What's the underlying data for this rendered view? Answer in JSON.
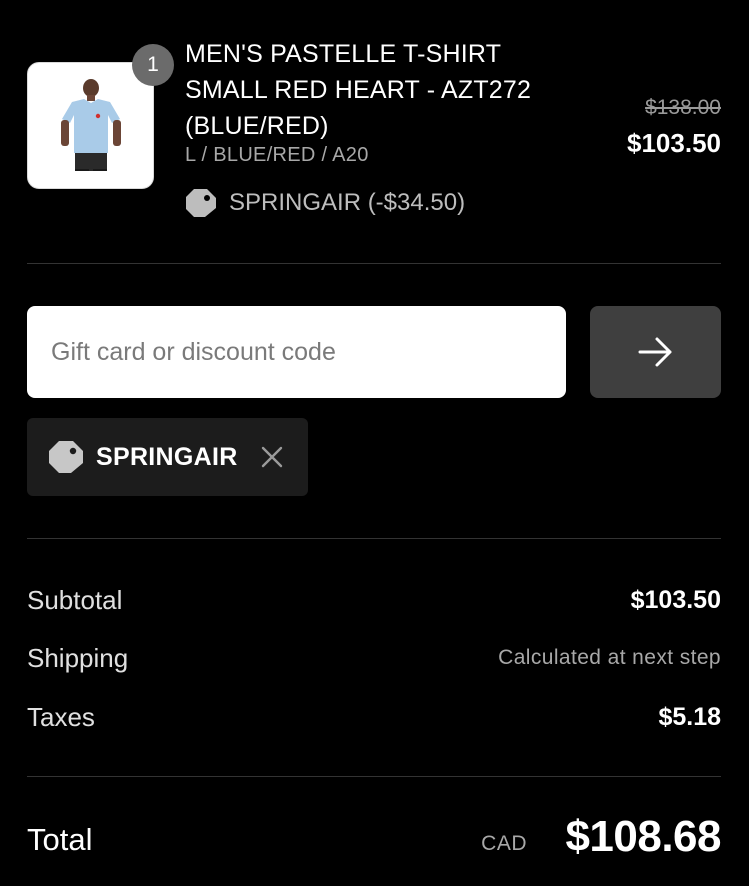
{
  "line_item": {
    "quantity": "1",
    "name": "MEN'S PASTELLE T-SHIRT SMALL RED HEART - AZT272 (BLUE/RED)",
    "variant": "L / BLUE/RED / A20",
    "discount_label": "SPRINGAIR (-$34.50)",
    "original_price": "$138.00",
    "price": "$103.50",
    "image_icon": "tshirt-image"
  },
  "discount_form": {
    "placeholder": "Gift card or discount code",
    "apply_icon": "arrow-right-icon"
  },
  "applied_code": {
    "code": "SPRINGAIR",
    "tag_icon": "tag-icon",
    "remove_icon": "close-icon"
  },
  "summary": {
    "subtotal_label": "Subtotal",
    "subtotal_value": "$103.50",
    "shipping_label": "Shipping",
    "shipping_value": "Calculated at next step",
    "taxes_label": "Taxes",
    "taxes_value": "$5.18"
  },
  "total": {
    "label": "Total",
    "currency": "CAD",
    "amount": "$108.68"
  },
  "colors": {
    "background": "#000000",
    "text": "#ffffff",
    "muted_text": "#a8a8a8",
    "divider": "#333333",
    "apply_button": "#3f3f3f",
    "chip_background": "#1c1c1c",
    "badge": "#6b6b6b"
  }
}
